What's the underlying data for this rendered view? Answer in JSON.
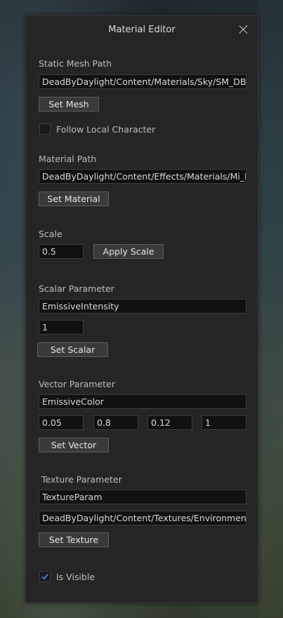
{
  "window": {
    "title": "Material Editor"
  },
  "static_mesh": {
    "label": "Static Mesh Path",
    "value": "DeadByDaylight/Content/Materials/Sky/SM_DBD_",
    "button": "Set Mesh",
    "follow_label": "Follow Local Character",
    "follow_checked": false
  },
  "material": {
    "label": "Material Path",
    "value": "DeadByDaylight/Content/Effects/Materials/Mi_Lig",
    "button": "Set Material"
  },
  "scale": {
    "label": "Scale",
    "value": "0.5",
    "button": "Apply Scale"
  },
  "scalar": {
    "label": "Scalar Parameter",
    "name": "EmissiveIntensity",
    "value": "1",
    "button": "Set Scalar"
  },
  "vector": {
    "label": "Vector Parameter",
    "name": "EmissiveColor",
    "x": "0.05",
    "y": "0.8",
    "z": "0.12",
    "w": "1",
    "button": "Set Vector"
  },
  "texture": {
    "label": "Texture Parameter",
    "name": "TextureParam",
    "path": "DeadByDaylight/Content/Textures/Environment/T",
    "button": "Set Texture"
  },
  "visible": {
    "label": "Is Visible",
    "checked": true
  },
  "colors": {
    "accent": "#3a7bd5",
    "panel": "#252525",
    "field": "#111111"
  }
}
